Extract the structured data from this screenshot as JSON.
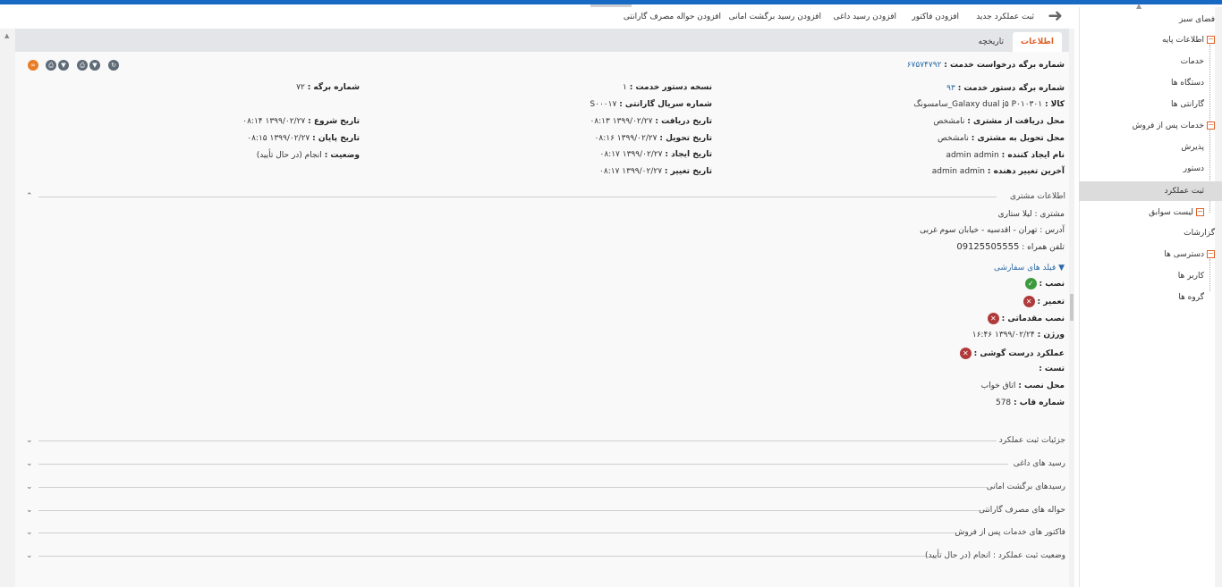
{
  "toolbar": {
    "links": [
      "ثبت عملکرد جدید",
      "افزودن فاکتور",
      "افزودن رسید داغی",
      "افزودن رسید برگشت امانی",
      "افزودن حواله مصرف گارانتی"
    ]
  },
  "sidebar": {
    "items": [
      {
        "label": "فضای سبز"
      },
      {
        "label": "اطلاعات پایه"
      },
      {
        "label": "خدمات"
      },
      {
        "label": "دستگاه ها"
      },
      {
        "label": "گارانتی ها"
      },
      {
        "label": "خدمات پس از فروش"
      },
      {
        "label": "پذیرش"
      },
      {
        "label": "دستور"
      },
      {
        "label": "ثبت عملکرد"
      },
      {
        "label": "لیست سوابق"
      },
      {
        "label": "گزارشات"
      },
      {
        "label": "دسترسی ها"
      },
      {
        "label": "کاربر ها"
      },
      {
        "label": "گروه ها"
      }
    ]
  },
  "tabs": {
    "info": "اطلاعات",
    "history": "تاریخچه"
  },
  "header": {
    "request_label": "شماره برگه درخواست خدمت :",
    "request_value": "۶۷۵۷۴۷۹۲"
  },
  "col1": {
    "order_no_label": "شماره برگه دستور خدمت :",
    "order_no_value": "۹۳",
    "goods_label": "کالا :",
    "goods_value": "Galaxy dual j۵ P۰۱۰۳۰۱_سامسونگ",
    "recv_place_label": "محل دریافت از مشتری :",
    "recv_place_value": "نامشخص",
    "deliv_place_label": "محل تحویل به مشتری :",
    "deliv_place_value": "نامشخص",
    "creator_label": "نام ایجاد کننده :",
    "creator_value": "admin admin",
    "modifier_label": "آخرین تغییر دهنده :",
    "modifier_value": "admin admin"
  },
  "col2": {
    "version_label": "نسخه دستور خدمت :",
    "version_value": "۱",
    "serial_label": "شماره سریال گارانتی :",
    "serial_value": "S۰۰۰۱۷",
    "recv_date_label": "تاریخ دریافت :",
    "recv_date_value": "۱۳۹۹/۰۲/۲۷ ۰۸:۱۳",
    "deliv_date_label": "تاریخ تحویل :",
    "deliv_date_value": "۱۳۹۹/۰۲/۲۷ ۰۸:۱۶",
    "create_date_label": "تاریخ ایجاد :",
    "create_date_value": "۱۳۹۹/۰۲/۲۷ ۰۸:۱۷",
    "change_date_label": "تاریخ تغییر :",
    "change_date_value": "۱۳۹۹/۰۲/۲۷ ۰۸:۱۷"
  },
  "col3": {
    "sheet_label": "شماره برگه :",
    "sheet_value": "۷۲",
    "start_label": "تاریخ شروع :",
    "start_value": "۱۳۹۹/۰۲/۲۷ ۰۸:۱۴",
    "end_label": "تاریخ پایان :",
    "end_value": "۱۳۹۹/۰۲/۲۷ ۰۸:۱۵",
    "status_label": "وضعیت :",
    "status_value": "انجام (در حال تأیید)"
  },
  "customer": {
    "section_title": "اطلاعات مشتری",
    "name_label": "مشتری :",
    "name_value": "لیلا ستاری",
    "address_label": "آدرس :",
    "address_value": "تهران - اقدسیه - خیابان سوم غربی",
    "phone_label": "تلفن همراه :",
    "phone_value": "09125505555"
  },
  "custom_fields": {
    "title": "فیلد های سفارشی",
    "install_label": "نصب :",
    "repair_label": "تعمیر :",
    "pre_install_label": "نصب مقدماتی :",
    "weight_label": "ورژن :",
    "weight_value": "۱۳۹۹/۰۲/۲۴ ۱۶:۴۶",
    "phone_ok_label": "عملکرد درست گوشی :",
    "test_label": "تست :",
    "place_label": "محل نصب :",
    "place_value": "اتاق خواب",
    "frame_label": "شماره قاب :",
    "frame_value": "578"
  },
  "sections": [
    "جزئیات ثبت عملکرد",
    "رسید های داغی",
    "رسیدهای برگشت امانی",
    "حواله های مصرف گارانتی",
    "فاکتور های خدمات پس از فروش",
    "وضعیت ثبت عملکرد : انجام (در حال تأیید)"
  ]
}
